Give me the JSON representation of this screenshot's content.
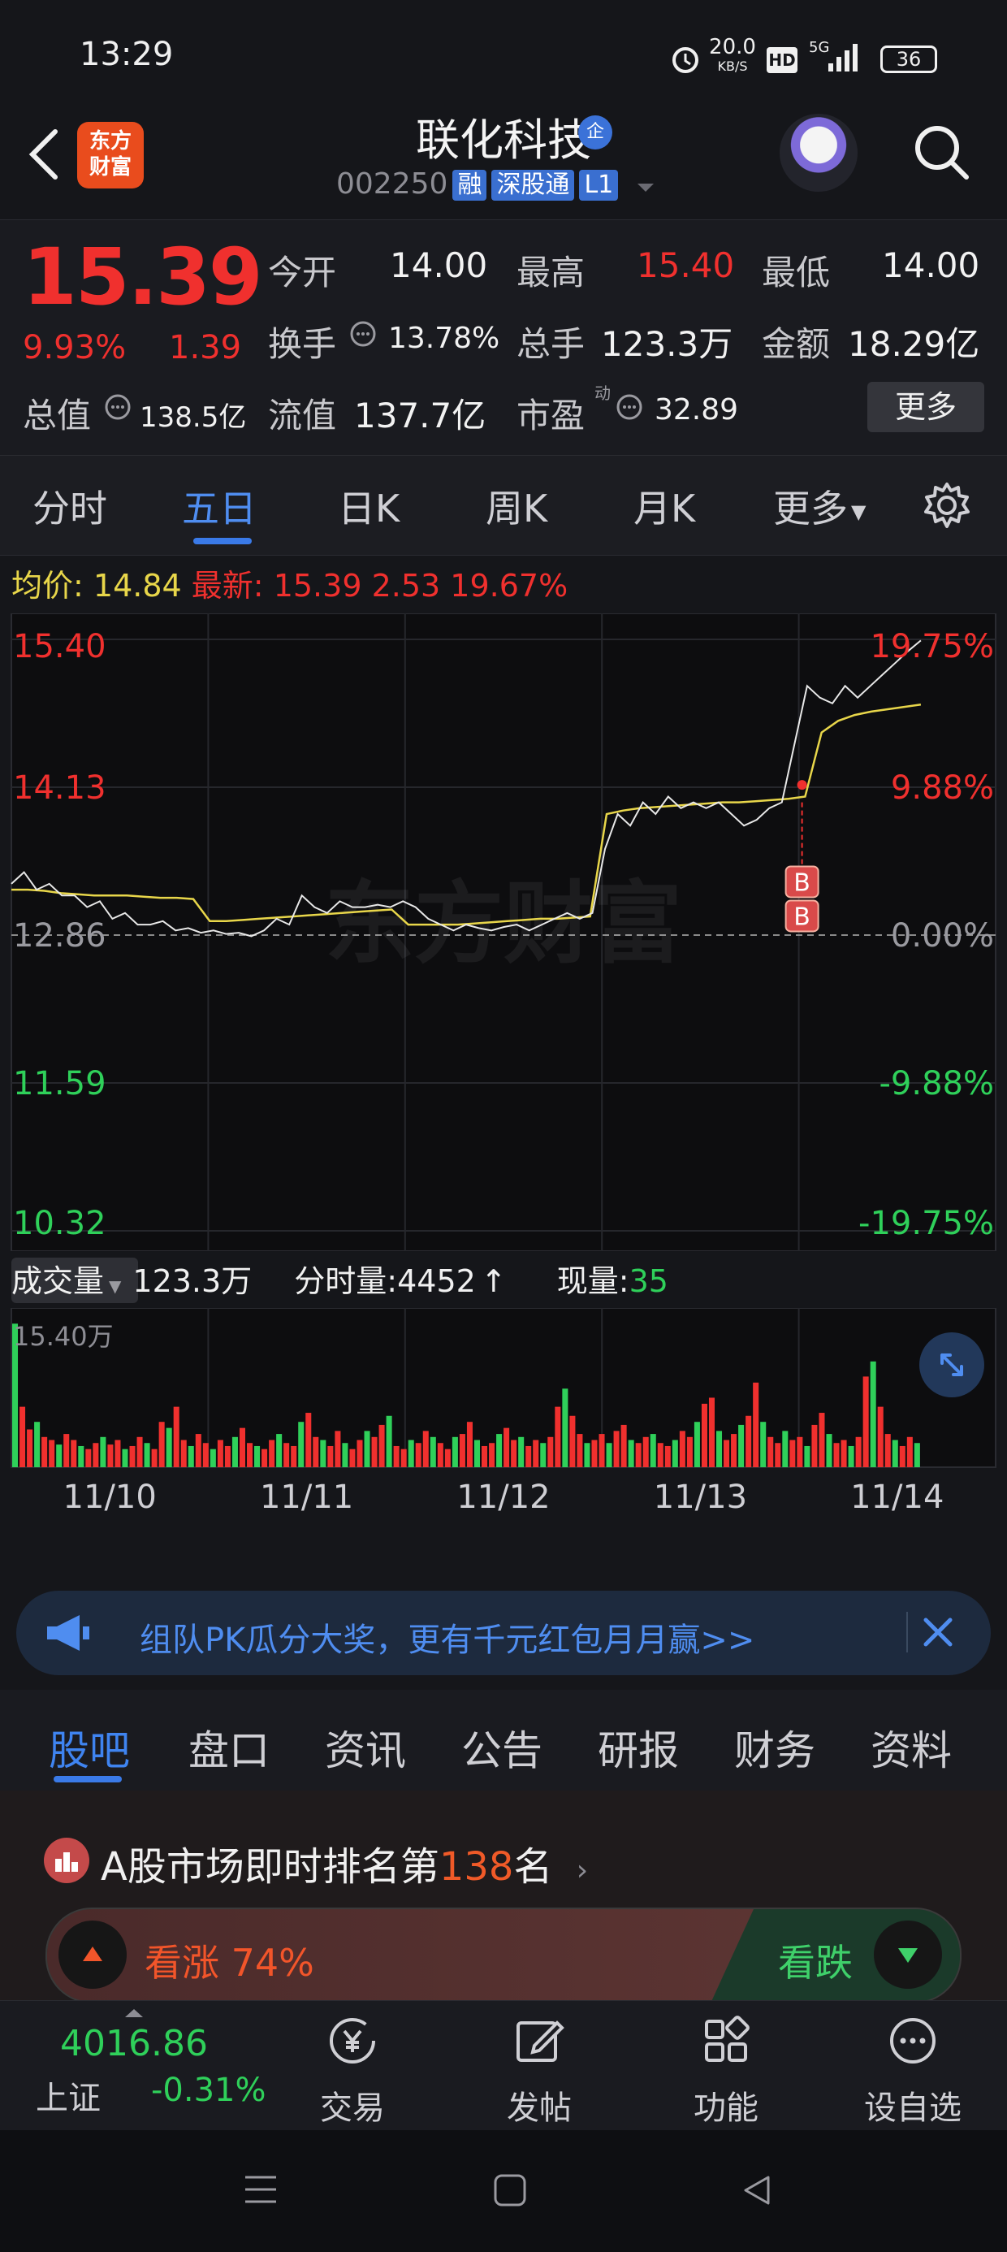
{
  "status_bar": {
    "time": "13:29",
    "net_speed": "20.0",
    "net_unit": "KB/S",
    "hd": "HD",
    "signal": "5G",
    "battery": "36"
  },
  "header": {
    "logo_line1": "东方",
    "logo_line2": "财富",
    "stock_name": "联化科技",
    "qi_badge": "企",
    "stock_code": "002250",
    "tags": [
      "融",
      "深股通",
      "L1"
    ]
  },
  "quote": {
    "price": "15.39",
    "change_pct": "9.93%",
    "change": "1.39",
    "open_label": "今开",
    "open": "14.00",
    "high_label": "最高",
    "high": "15.40",
    "low_label": "最低",
    "low": "14.00",
    "turnover_label": "换手",
    "turnover": "13.78%",
    "volume_label": "总手",
    "volume": "123.3万",
    "amount_label": "金额",
    "amount": "18.29亿",
    "mcap_label": "总值",
    "mcap": "138.5亿",
    "float_label": "流值",
    "float_cap": "137.7亿",
    "pe_label": "市盈",
    "pe_sup": "动",
    "pe": "32.89",
    "more": "更多"
  },
  "chart_tabs": [
    "分时",
    "五日",
    "日K",
    "周K",
    "月K",
    "更多"
  ],
  "chart_info": {
    "avg_label": "均价:",
    "avg": "14.84",
    "latest_label": "最新:",
    "latest": "15.39",
    "diff": "2.53",
    "pct": "19.67%"
  },
  "chart_data": {
    "type": "line",
    "title": "",
    "x": [
      "11/10",
      "11/11",
      "11/12",
      "11/13",
      "11/14"
    ],
    "y_ticks_left": [
      "15.40",
      "14.13",
      "12.86",
      "11.59",
      "10.32"
    ],
    "y_ticks_right": [
      "19.75%",
      "9.88%",
      "0.00%",
      "-9.88%",
      "-19.75%"
    ],
    "ylim": [
      10.32,
      15.4
    ],
    "baseline": 12.86,
    "series": [
      {
        "values": [
          13.3,
          13.4,
          13.25,
          13.3,
          13.2,
          13.2,
          13.1,
          13.15,
          13.0,
          13.05,
          12.95,
          12.95,
          12.98,
          12.9,
          12.92,
          12.88,
          12.9,
          12.87,
          12.88,
          12.85,
          12.9,
          13.0,
          12.95,
          13.2,
          13.1,
          13.05,
          13.15,
          13.1,
          13.1,
          13.12,
          13.1,
          13.15,
          13.1,
          13.0,
          12.95,
          12.9,
          12.95,
          12.92,
          12.9,
          12.93,
          12.95,
          12.9,
          12.95,
          13.0,
          13.05,
          13.0,
          13.05,
          13.6,
          13.9,
          13.8,
          14.0,
          13.9,
          14.05,
          13.95,
          14.0,
          13.95,
          14.0,
          13.9,
          13.8,
          13.85,
          13.95,
          14.0,
          14.5,
          15.0,
          14.9,
          14.85,
          15.0,
          14.9,
          15.0,
          15.1,
          15.2,
          15.3,
          15.39
        ]
      },
      {
        "values": [
          13.25,
          13.25,
          13.24,
          13.22,
          13.21,
          13.2,
          13.2,
          13.2,
          13.19,
          13.18,
          13.18,
          13.17,
          12.98,
          12.98,
          12.99,
          13.0,
          13.01,
          13.02,
          13.03,
          13.04,
          13.05,
          13.06,
          13.07,
          13.08,
          12.95,
          12.95,
          12.95,
          12.95,
          12.96,
          12.97,
          12.98,
          12.99,
          13.0,
          13.0,
          13.01,
          13.02,
          13.9,
          13.93,
          13.95,
          13.96,
          13.97,
          13.98,
          13.99,
          14.0,
          14.0,
          14.01,
          14.02,
          14.03,
          14.05,
          14.6,
          14.7,
          14.75,
          14.78,
          14.8,
          14.82,
          14.84
        ]
      }
    ],
    "trade_markers": [
      "B",
      "B"
    ],
    "volume": {
      "label": "成交量",
      "total": "123.3万",
      "minute_label": "分时量:",
      "minute": "4452",
      "current_label": "现量:",
      "current": "35",
      "max_label": "15.40万",
      "bars": [
        95,
        40,
        25,
        30,
        20,
        18,
        15,
        22,
        18,
        14,
        12,
        16,
        20,
        15,
        18,
        12,
        14,
        20,
        16,
        12,
        30,
        26,
        40,
        18,
        14,
        22,
        16,
        12,
        18,
        14,
        20,
        26,
        16,
        14,
        12,
        18,
        22,
        16,
        14,
        30,
        36,
        20,
        18,
        14,
        24,
        16,
        12,
        18,
        24,
        20,
        28,
        34,
        14,
        12,
        18,
        16,
        24,
        20,
        16,
        12,
        20,
        22,
        30,
        18,
        14,
        16,
        22,
        26,
        18,
        20,
        14,
        18,
        16,
        20,
        40,
        52,
        34,
        22,
        16,
        18,
        22,
        16,
        24,
        28,
        18,
        16,
        20,
        22,
        16,
        14,
        18,
        24,
        20,
        30,
        42,
        46,
        24,
        18,
        22,
        28,
        34,
        56,
        30,
        20,
        16,
        24,
        18,
        20,
        14,
        28,
        36,
        22,
        16,
        18,
        14,
        20,
        60,
        70,
        40,
        22,
        18,
        14,
        20,
        16
      ]
    }
  },
  "banner": {
    "text": "组队PK瓜分大奖，更有千元红包月月赢>>"
  },
  "section_tabs": [
    "股吧",
    "盘口",
    "资讯",
    "公告",
    "研报",
    "财务",
    "资料"
  ],
  "ranking": {
    "prefix": "A股市场即时排名第",
    "rank": "138",
    "suffix": "名"
  },
  "vote": {
    "up_label": "看涨",
    "up_pct": "74%",
    "down_label": "看跌"
  },
  "bottom_nav": {
    "index_value": "4016.86",
    "index_name": "上证",
    "index_pct": "-0.31%",
    "items": [
      "交易",
      "发帖",
      "功能",
      "设自选"
    ]
  },
  "colors": {
    "up": "#f0302e",
    "down": "#2fd05a",
    "accent": "#3a7ae8",
    "avg_line": "#e8d64a"
  }
}
